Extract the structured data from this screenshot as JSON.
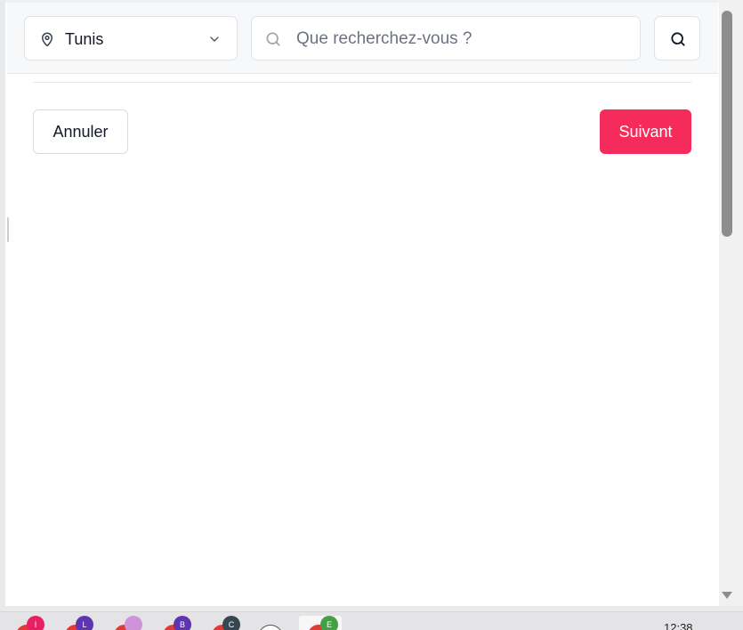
{
  "search_bar": {
    "location": {
      "value": "Tunis",
      "icon": "map-pin-icon",
      "dropdown_icon": "chevron-down-icon"
    },
    "query": {
      "placeholder": "Que recherchez-vous ?",
      "value": "",
      "icon": "search-icon"
    },
    "submit": {
      "icon": "search-icon"
    }
  },
  "form_actions": {
    "cancel_label": "Annuler",
    "next_label": "Suivant"
  },
  "colors": {
    "accent": "#f52b5b",
    "border": "#dfe2e6",
    "header_bg": "#f6f8fa"
  },
  "taskbar": {
    "apps": [
      {
        "name": "app-1",
        "badge": "I",
        "badge_color": "#e91e63"
      },
      {
        "name": "app-2",
        "badge": "L",
        "badge_color": "#5e35b1"
      },
      {
        "name": "app-3",
        "badge": "",
        "badge_color": "#ce93d8"
      },
      {
        "name": "app-4",
        "badge": "B",
        "badge_color": "#5e35b1"
      },
      {
        "name": "app-5",
        "badge": "C",
        "badge_color": "#37474f"
      },
      {
        "name": "app-6",
        "badge": "",
        "badge_color": "#ffffff"
      },
      {
        "name": "app-7",
        "badge": "E",
        "badge_color": "#43a047"
      }
    ],
    "clock": "12:38"
  }
}
